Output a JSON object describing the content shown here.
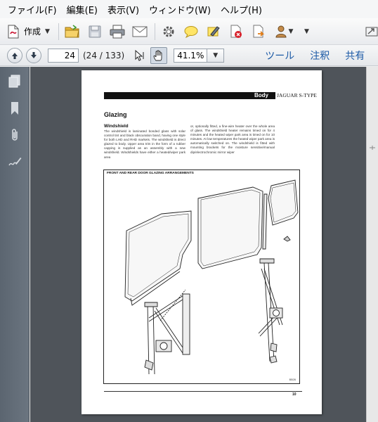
{
  "menu": [
    "ファイル(F)",
    "編集(E)",
    "表示(V)",
    "ウィンドウ(W)",
    "ヘルプ(H)"
  ],
  "toolbar": {
    "create_label": "作成",
    "icons": [
      "create-pdf-icon",
      "open-folder-icon",
      "save-icon",
      "print-icon",
      "email-icon",
      "settings-gear-icon",
      "comment-bubble-icon",
      "highlight-pen-icon",
      "delete-pdf-icon",
      "export-icon",
      "user-stamp-icon",
      "fullscreen-icon"
    ]
  },
  "nav": {
    "page_value": "24",
    "page_count": "(24 / 133)",
    "zoom_value": "41.1%",
    "tools_label": "ツール",
    "comment_label": "注釈",
    "share_label": "共有"
  },
  "document": {
    "header_section": "Body",
    "header_brand": "JAGUAR S-TYPE",
    "section_title": "Glazing",
    "subsection_title": "Windshield",
    "col1_text": "The windshield is laminated bonded glass with solar control tint and black obscuration band, having one style for both LHD and RHD markets. The windshield is direct glazed to body. Upper area trim in the form of a rubber capping is supplied as an assembly with a new windshield. Windshields have either a heated/wiper park area",
    "col2_text": "or, optionally fitted, a fine-wire heater over the whole area of glass. The windshield heater remains timed on for 4 minutes and the heated wiper park area is timed on for 10 minutes. At low temperatures the heated wiper park area is automatically switched on. The windshield is fitted with mounting brackets for the moisture sensitive/manual dip/electrochromic mirror wiper",
    "figure_title": "FRONT AND REAR DOOR GLAZING ARRANGEMENTS",
    "figure_ref": "B5/26",
    "page_number": "10"
  },
  "colors": {
    "viewport_bg": "#4f545a",
    "sidebar_bg": "#5b6570",
    "link_blue": "#1c5aa6"
  }
}
